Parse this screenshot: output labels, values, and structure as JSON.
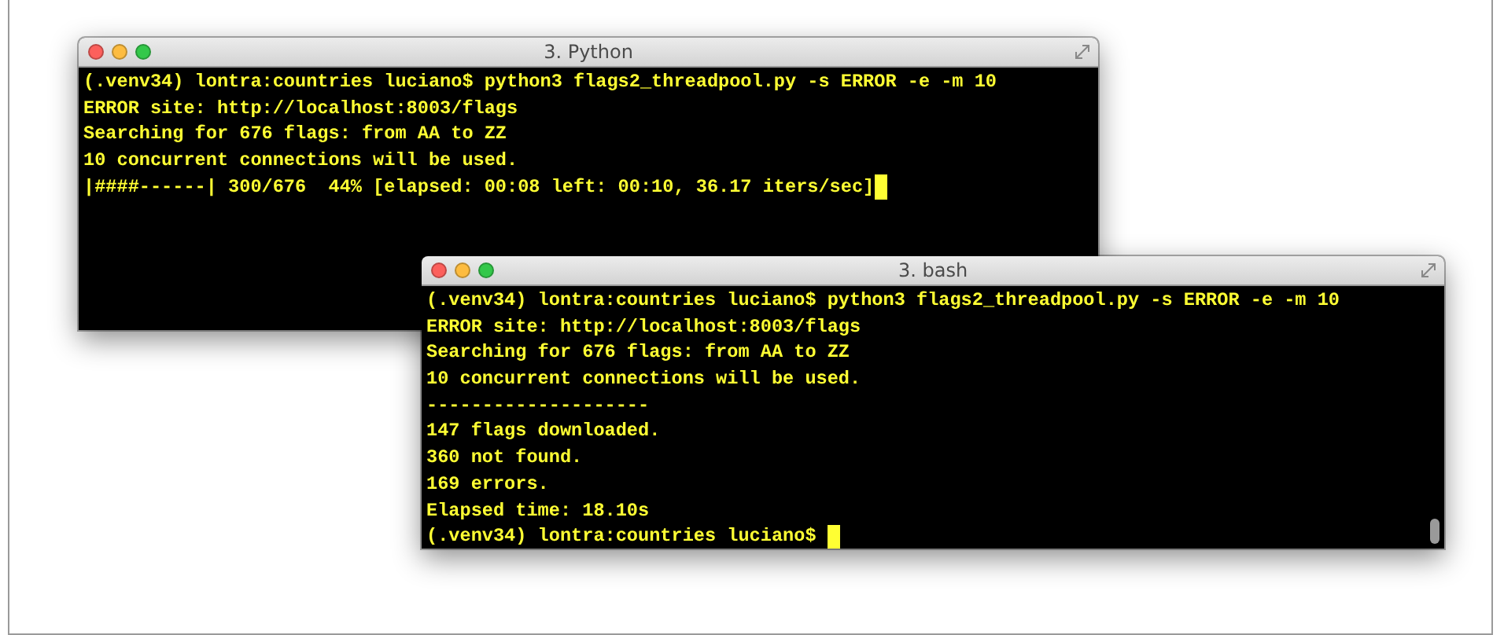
{
  "windows": [
    {
      "title": "3. Python",
      "lines": [
        "(.venv34) lontra:countries luciano$ python3 flags2_threadpool.py -s ERROR -e -m 10",
        "ERROR site: http://localhost:8003/flags",
        "Searching for 676 flags: from AA to ZZ",
        "10 concurrent connections will be used.",
        "|####------| 300/676  44% [elapsed: 00:08 left: 00:10, 36.17 iters/sec]"
      ]
    },
    {
      "title": "3. bash",
      "scrollbar": true,
      "lines": [
        "(.venv34) lontra:countries luciano$ python3 flags2_threadpool.py -s ERROR -e -m 10",
        "ERROR site: http://localhost:8003/flags",
        "Searching for 676 flags: from AA to ZZ",
        "10 concurrent connections will be used.",
        "--------------------",
        "147 flags downloaded.",
        "360 not found.",
        "169 errors.",
        "Elapsed time: 18.10s",
        "(.venv34) lontra:countries luciano$ "
      ]
    }
  ]
}
